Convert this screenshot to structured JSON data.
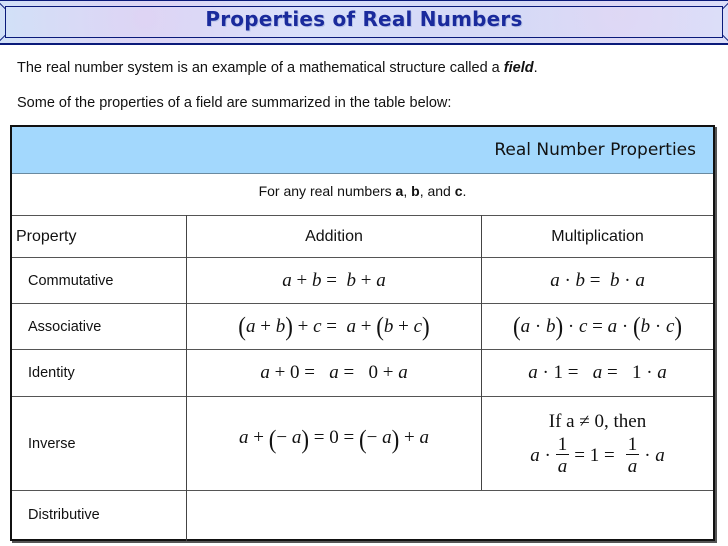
{
  "banner": {
    "title": "Properties of Real Numbers"
  },
  "intro": {
    "line1_text": "The real number system is an example of a mathematical structure called a ",
    "line1_emphasis": "field",
    "line1_end": ".",
    "line2": "Some of the properties of a field are summarized in the table below:"
  },
  "table": {
    "caption": "Real Number Properties",
    "subtitle": {
      "prefix": "For any real numbers ",
      "vars": [
        "a",
        "b",
        "c"
      ],
      "sep1": ", ",
      "sep2": ",  and ",
      "suffix": "."
    },
    "columns": [
      "Property",
      "Addition",
      "Multiplication"
    ],
    "rows": [
      {
        "property": "Commutative",
        "addition": "a + b = b + a",
        "multiplication": "a · b = b · a"
      },
      {
        "property": "Associative",
        "addition": "(a + b) + c = a + (b + c)",
        "multiplication": "(a · b) · c = a · (b · c)"
      },
      {
        "property": "Identity",
        "addition": "a + 0 = a = 0 + a",
        "multiplication": "a · 1 = a = 1 · a"
      },
      {
        "property": "Inverse",
        "addition": "a + (− a) = 0 = (− a) + a",
        "multiplication": {
          "condition": "If a ≠ 0,  then",
          "lhs": "a ·",
          "frac_num": "1",
          "frac_den": "a",
          "mid": "= 1 =",
          "rhs": "· a"
        }
      },
      {
        "property": "Distributive",
        "addition": "",
        "multiplication": ""
      }
    ]
  },
  "colors": {
    "header_blue": "#a3d8fd",
    "banner_text": "#1a2a9c",
    "banner_border": "#0a1a7a"
  }
}
